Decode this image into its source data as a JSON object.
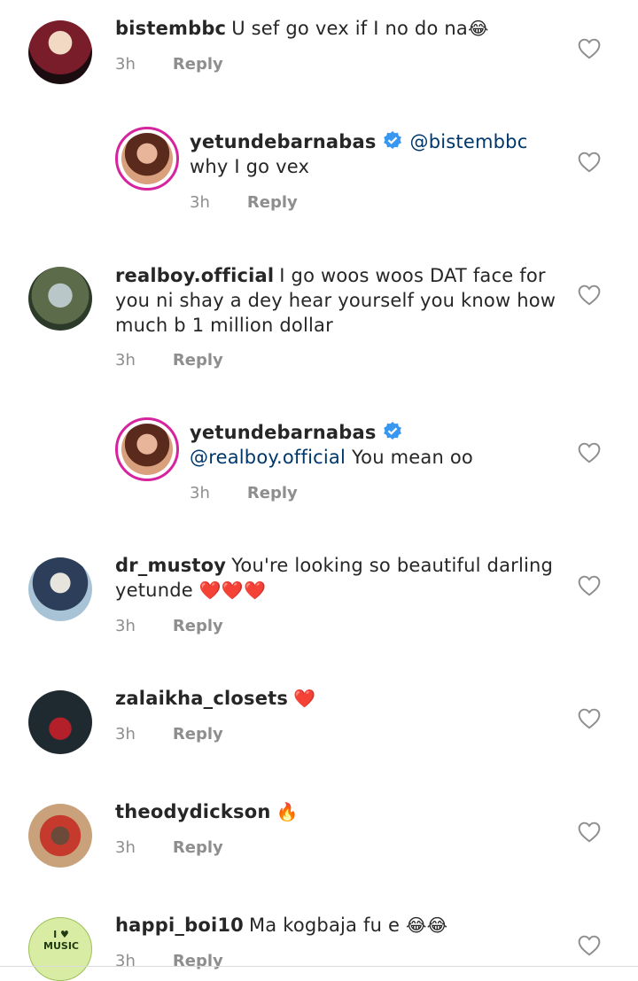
{
  "comments": [
    {
      "user": "bistembbc",
      "text": "U sef go vex if I no do na",
      "emoji": "😂",
      "time": "3h",
      "reply": "Reply",
      "avatar": "#3a1a20"
    },
    {
      "user": "yetundebarnabas",
      "mention": "@bistembbc",
      "text": "why I go vex",
      "time": "3h",
      "reply": "Reply",
      "avatar": "#c28a6b"
    },
    {
      "user": "realboy.official",
      "text": "I go woos woos DAT face for you ni shay a dey hear yourself you know how much b 1 million  dollar",
      "time": "3h",
      "reply": "Reply",
      "avatar": "#5c6b4a"
    },
    {
      "user": "yetundebarnabas",
      "mention": "@realboy.official",
      "text": "You mean oo",
      "time": "3h",
      "reply": "Reply",
      "avatar": "#c28a6b"
    },
    {
      "user": "dr_mustoy",
      "text": "You're looking so beautiful darling yetunde",
      "emoji": "❤️❤️❤️",
      "time": "3h",
      "reply": "Reply",
      "avatar": "#7b98b5"
    },
    {
      "user": "zalaikha_closets",
      "text": "",
      "emoji": "❤️",
      "time": "3h",
      "reply": "Reply",
      "avatar": "#1f2a30"
    },
    {
      "user": "theodydickson",
      "text": "",
      "emoji": "🔥",
      "time": "3h",
      "reply": "Reply",
      "avatar": "#8a6a50"
    },
    {
      "user": "happi_boi10",
      "text": "Ma kogbaja fu e",
      "emoji": "😂😂",
      "time": "3h",
      "reply": "Reply",
      "avatar": "#b7d77a"
    }
  ],
  "avatar_label": "I ♥ MUSIC"
}
